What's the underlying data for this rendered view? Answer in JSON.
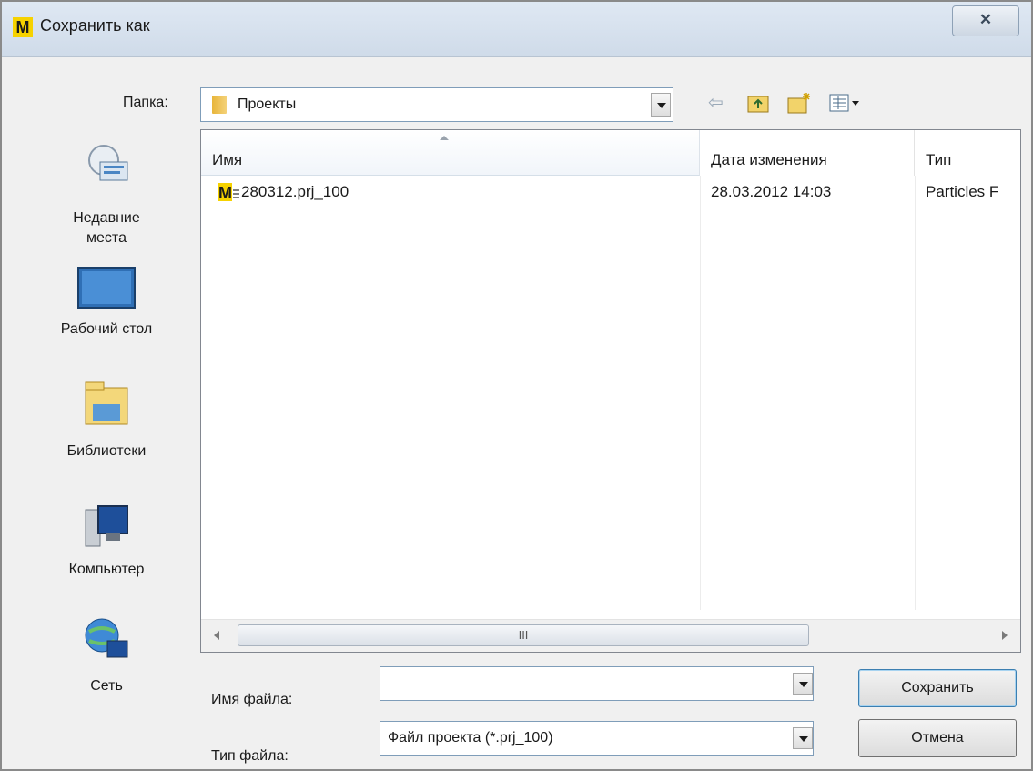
{
  "window": {
    "title": "Сохранить как",
    "app_icon_letter": "M",
    "close_glyph": "✕"
  },
  "toolbar": {
    "folder_label": "Папка:",
    "current_folder": "Проекты",
    "icons": [
      "back-arrow-icon",
      "up-folder-icon",
      "new-folder-icon",
      "view-menu-icon"
    ]
  },
  "places": [
    {
      "label_line1": "Недавние",
      "label_line2": "места",
      "icon": "recent-places-icon"
    },
    {
      "label_line1": "Рабочий стол",
      "label_line2": "",
      "icon": "desktop-icon"
    },
    {
      "label_line1": "Библиотеки",
      "label_line2": "",
      "icon": "libraries-icon"
    },
    {
      "label_line1": "Компьютер",
      "label_line2": "",
      "icon": "computer-icon"
    },
    {
      "label_line1": "Сеть",
      "label_line2": "",
      "icon": "network-icon"
    }
  ],
  "file_list": {
    "columns": [
      "Имя",
      "Дата изменения",
      "Тип"
    ],
    "rows": [
      {
        "name": "280312.prj_100",
        "date": "28.03.2012 14:03",
        "type": "Particles F",
        "icon_letter": "M"
      }
    ],
    "scroll_thumb_glyph": "III"
  },
  "form": {
    "filename_label": "Имя файла:",
    "filename_value": "",
    "filetype_label": "Тип файла:",
    "filetype_value": "Файл проекта (*.prj_100)"
  },
  "buttons": {
    "save": "Сохранить",
    "cancel": "Отмена"
  },
  "colors": {
    "title_bar": "#cfdbe9",
    "accent_yellow": "#f6d200",
    "header_highlight": "#f1f5fa"
  }
}
